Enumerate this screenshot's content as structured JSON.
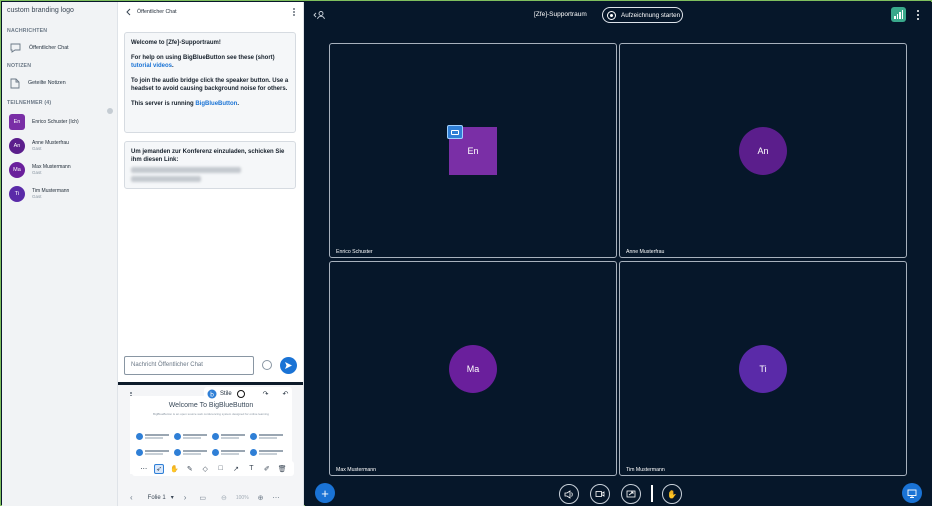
{
  "sidebar": {
    "logo": "custom branding logo",
    "messages_section": "NACHRICHTEN",
    "public_chat": "Öffentlicher Chat",
    "notes_section": "NOTIZEN",
    "shared_notes": "Geteilte Notizen",
    "participants_section": "TEILNEHMER (4)",
    "users": [
      {
        "initials": "En",
        "name": "Enrico Schuster (Ich)",
        "role": "",
        "color": "#7a2fa6"
      },
      {
        "initials": "An",
        "name": "Anne Musterfrau",
        "role": "Gast",
        "color": "#5b1e8c"
      },
      {
        "initials": "Ma",
        "name": "Max Mustermann",
        "role": "Gast",
        "color": "#6a1f9c"
      },
      {
        "initials": "Ti",
        "name": "Tim Mustermann",
        "role": "Gast",
        "color": "#5a2aa8"
      }
    ]
  },
  "chat": {
    "title": "Öffentlicher Chat",
    "welcome_title": "Welcome to [Zfe]-Supportraum!",
    "help_text": "For help on using BigBlueButton see these (short)",
    "help_link": "tutorial videos",
    "audio_text": "To join the audio bridge click the speaker button. Use a headset to avoid causing background noise for others.",
    "server_text": "This server is running",
    "server_link": "BigBlueButton",
    "invite_text": "Um jemanden zur Konferenz einzuladen, schicken Sie ihm diesen Link:",
    "input_placeholder": "Nachricht Öffentlicher Chat"
  },
  "whiteboard": {
    "slide_title": "Welcome To BigBlueButton",
    "slide_subtitle": "BigBlueButton is an open source web conferencing system designed for online learning",
    "styles_label": "Stile",
    "slide_label": "Folie 1",
    "zoom": "100%"
  },
  "main": {
    "room_name": "[Zfe]-Supportraum",
    "record_label": "Aufzeichnung starten",
    "tiles": [
      {
        "initials": "En",
        "name": "Enrico Schuster",
        "color": "#7a2fa6"
      },
      {
        "initials": "An",
        "name": "Anne Musterfrau",
        "color": "#5b1e8c"
      },
      {
        "initials": "Ma",
        "name": "Max Mustermann",
        "color": "#6a1f9c"
      },
      {
        "initials": "Ti",
        "name": "Tim Mustermann",
        "color": "#5a2aa8"
      }
    ]
  }
}
